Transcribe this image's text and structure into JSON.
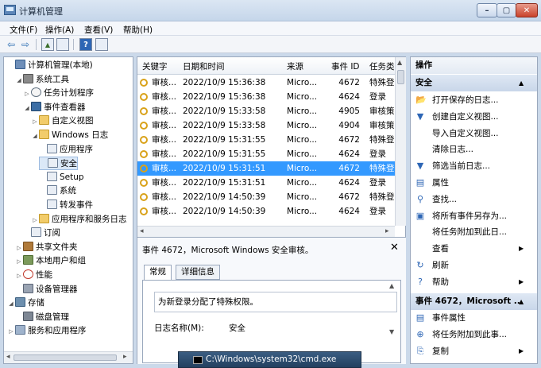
{
  "window": {
    "title": "计算机管理",
    "min": "–",
    "max": "▢",
    "close": "✕"
  },
  "menu": [
    "文件(F)",
    "操作(A)",
    "查看(V)",
    "帮助(H)"
  ],
  "toolbar": {
    "back": "⇦",
    "forward": "⇨",
    "up": "▲",
    "help": "?"
  },
  "tree": [
    {
      "label": "计算机管理(本地)",
      "icon": "pc",
      "arrow": ""
    },
    {
      "label": "系统工具",
      "icon": "tool",
      "arrow": "◢"
    },
    {
      "label": "任务计划程序",
      "icon": "clock",
      "arrow": "▷"
    },
    {
      "label": "事件查看器",
      "icon": "ev",
      "arrow": "◢"
    },
    {
      "label": "自定义视图",
      "icon": "folder",
      "arrow": "▷"
    },
    {
      "label": "Windows 日志",
      "icon": "folder",
      "arrow": "◢"
    },
    {
      "label": "应用程序",
      "icon": "log",
      "arrow": ""
    },
    {
      "label": "安全",
      "icon": "log",
      "arrow": ""
    },
    {
      "label": "Setup",
      "icon": "log",
      "arrow": ""
    },
    {
      "label": "系统",
      "icon": "log",
      "arrow": ""
    },
    {
      "label": "转发事件",
      "icon": "log",
      "arrow": ""
    },
    {
      "label": "应用程序和服务日志",
      "icon": "folder",
      "arrow": "▷"
    },
    {
      "label": "订阅",
      "icon": "log",
      "arrow": ""
    },
    {
      "label": "共享文件夹",
      "icon": "share",
      "arrow": "▷"
    },
    {
      "label": "本地用户和组",
      "icon": "user",
      "arrow": "▷"
    },
    {
      "label": "性能",
      "icon": "perf",
      "arrow": "▷"
    },
    {
      "label": "设备管理器",
      "icon": "dev",
      "arrow": ""
    },
    {
      "label": "存储",
      "icon": "store",
      "arrow": "◢"
    },
    {
      "label": "磁盘管理",
      "icon": "disk",
      "arrow": ""
    },
    {
      "label": "服务和应用程序",
      "icon": "svc",
      "arrow": "▷"
    }
  ],
  "events": {
    "headers": [
      "关键字",
      "日期和时间",
      "来源",
      "事件 ID",
      "任务类"
    ],
    "rows": [
      [
        "审核...",
        "2022/10/9 15:36:38",
        "Micro...",
        "4672",
        "特殊登"
      ],
      [
        "审核...",
        "2022/10/9 15:36:38",
        "Micro...",
        "4624",
        "登录"
      ],
      [
        "审核...",
        "2022/10/9 15:33:58",
        "Micro...",
        "4905",
        "审核策"
      ],
      [
        "审核...",
        "2022/10/9 15:33:58",
        "Micro...",
        "4904",
        "审核策"
      ],
      [
        "审核...",
        "2022/10/9 15:31:55",
        "Micro...",
        "4672",
        "特殊登"
      ],
      [
        "审核...",
        "2022/10/9 15:31:55",
        "Micro...",
        "4624",
        "登录"
      ],
      [
        "审核...",
        "2022/10/9 15:31:51",
        "Micro...",
        "4672",
        "特殊登"
      ],
      [
        "审核...",
        "2022/10/9 15:31:51",
        "Micro...",
        "4624",
        "登录"
      ],
      [
        "审核...",
        "2022/10/9 14:50:39",
        "Micro...",
        "4672",
        "特殊登"
      ],
      [
        "审核...",
        "2022/10/9 14:50:39",
        "Micro...",
        "4624",
        "登录"
      ]
    ],
    "selected_index": 6
  },
  "detail": {
    "title": "事件 4672，Microsoft Windows 安全审核。",
    "close": "✕",
    "tabs": [
      "常规",
      "详细信息"
    ],
    "description": "为新登录分配了特殊权限。",
    "log_name_label": "日志名称(M):",
    "log_name_value": "安全"
  },
  "actions": {
    "header": "操作",
    "section1": "安全",
    "items": [
      {
        "label": "打开保存的日志...",
        "icon": "📂",
        "arrow": ""
      },
      {
        "label": "创建自定义视图...",
        "icon": "▼",
        "arrow": ""
      },
      {
        "label": "导入自定义视图...",
        "icon": "",
        "arrow": ""
      },
      {
        "label": "清除日志...",
        "icon": "",
        "arrow": ""
      },
      {
        "label": "筛选当前日志...",
        "icon": "▼",
        "arrow": ""
      },
      {
        "label": "属性",
        "icon": "▤",
        "arrow": ""
      },
      {
        "label": "查找...",
        "icon": "⚲",
        "arrow": ""
      },
      {
        "label": "将所有事件另存为...",
        "icon": "▣",
        "arrow": ""
      },
      {
        "label": "将任务附加到此日...",
        "icon": "",
        "arrow": ""
      },
      {
        "label": "查看",
        "icon": "",
        "arrow": "▶"
      },
      {
        "label": "刷新",
        "icon": "↻",
        "arrow": ""
      },
      {
        "label": "帮助",
        "icon": "?",
        "arrow": "▶"
      }
    ],
    "section2": "事件 4672，Microsoft ...",
    "items2": [
      {
        "label": "事件属性",
        "icon": "▤",
        "arrow": ""
      },
      {
        "label": "将任务附加到此事...",
        "icon": "⊕",
        "arrow": ""
      },
      {
        "label": "复制",
        "icon": "⎘",
        "arrow": "▶"
      }
    ]
  },
  "taskbar_cmd": "C:\\Windows\\system32\\cmd.exe"
}
